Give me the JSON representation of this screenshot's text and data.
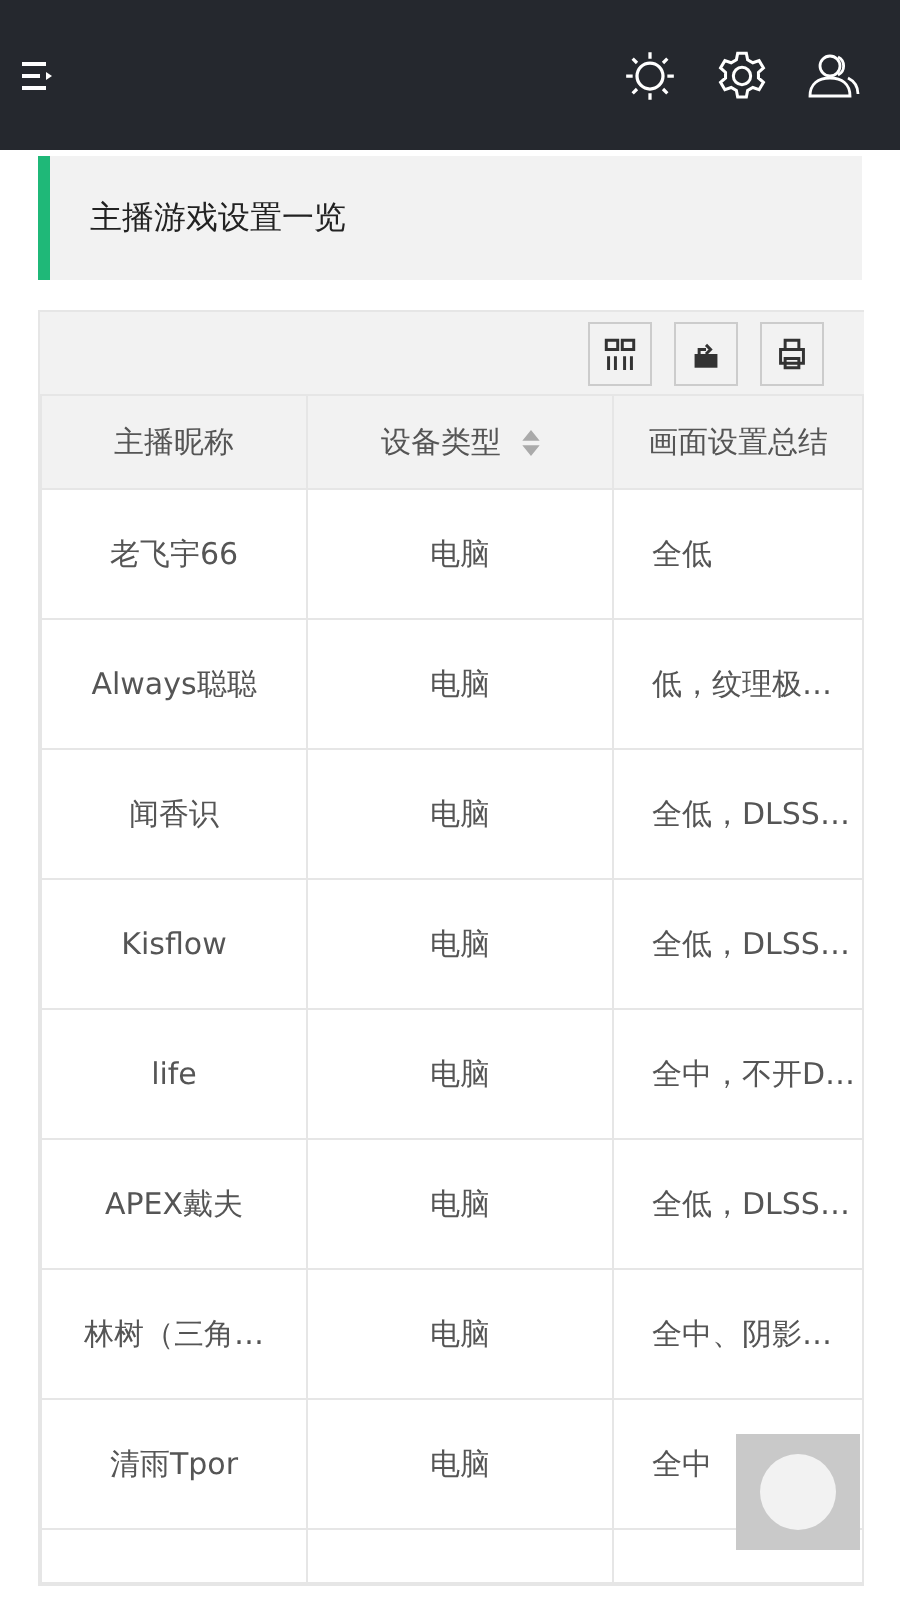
{
  "page_title": "主播游戏设置一览",
  "table": {
    "columns": [
      {
        "label": "主播昵称",
        "sortable": false
      },
      {
        "label": "设备类型",
        "sortable": true
      },
      {
        "label": "画面设置总结",
        "sortable": false
      }
    ],
    "rows": [
      [
        "老飞宇66",
        "电脑",
        "全低"
      ],
      [
        "Always聪聪",
        "电脑",
        "低，纹理极…"
      ],
      [
        "闻香识",
        "电脑",
        "全低，DLSS…"
      ],
      [
        "Kisflow",
        "电脑",
        "全低，DLSS…"
      ],
      [
        "life",
        "电脑",
        "全中，不开D…"
      ],
      [
        "APEX戴夫",
        "电脑",
        "全低，DLSS…"
      ],
      [
        "林树（三角…",
        "电脑",
        "全中、阴影…"
      ],
      [
        "清雨Tpor",
        "电脑",
        "全中"
      ]
    ]
  }
}
